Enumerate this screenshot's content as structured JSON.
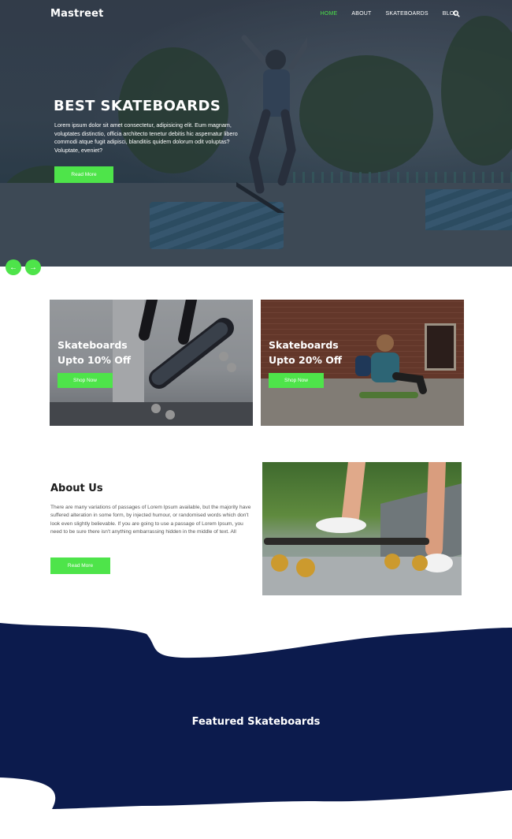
{
  "brand": {
    "logo": "Mastreet",
    "accent_color": "#4ee44a",
    "navy_color": "#0c1b4d"
  },
  "nav": {
    "items": [
      {
        "label": "HOME",
        "active": true
      },
      {
        "label": "ABOUT",
        "active": false
      },
      {
        "label": "SKATEBOARDS",
        "active": false
      },
      {
        "label": "BLOG",
        "active": false
      }
    ],
    "search_icon": "search-icon"
  },
  "hero": {
    "title": "BEST SKATEBOARDS",
    "text": "Lorem ipsum dolor sit amet consectetur, adipisicing elit. Eum magnam, voluptates distinctio, officia architecto tenetur debitis hic aspernatur libero commodi atque fugit adipisci, blanditiis quidem dolorum odit voluptas? Voluptate, eveniet?",
    "button": "Read More",
    "prev_icon": "arrow-left-icon",
    "next_icon": "arrow-right-icon",
    "prev_glyph": "←",
    "next_glyph": "→"
  },
  "promos": [
    {
      "title_line1": "Skateboards",
      "title_line2": "Upto 10% Off",
      "button": "Shop Now"
    },
    {
      "title_line1": "Skateboards",
      "title_line2": "Upto 20% Off",
      "button": "Shop Now"
    }
  ],
  "about": {
    "title": "About Us",
    "text": "There are many variations of passages of Lorem Ipsum available, but the majority have suffered alteration in some form, by injected humour, or randomised words which don't look even slightly believable. If you are going to use a passage of Lorem Ipsum, you need to be sure there isn't anything embarrassing hidden in the middle of text. All",
    "button": "Read More"
  },
  "featured": {
    "title": "Featured Skateboards"
  }
}
